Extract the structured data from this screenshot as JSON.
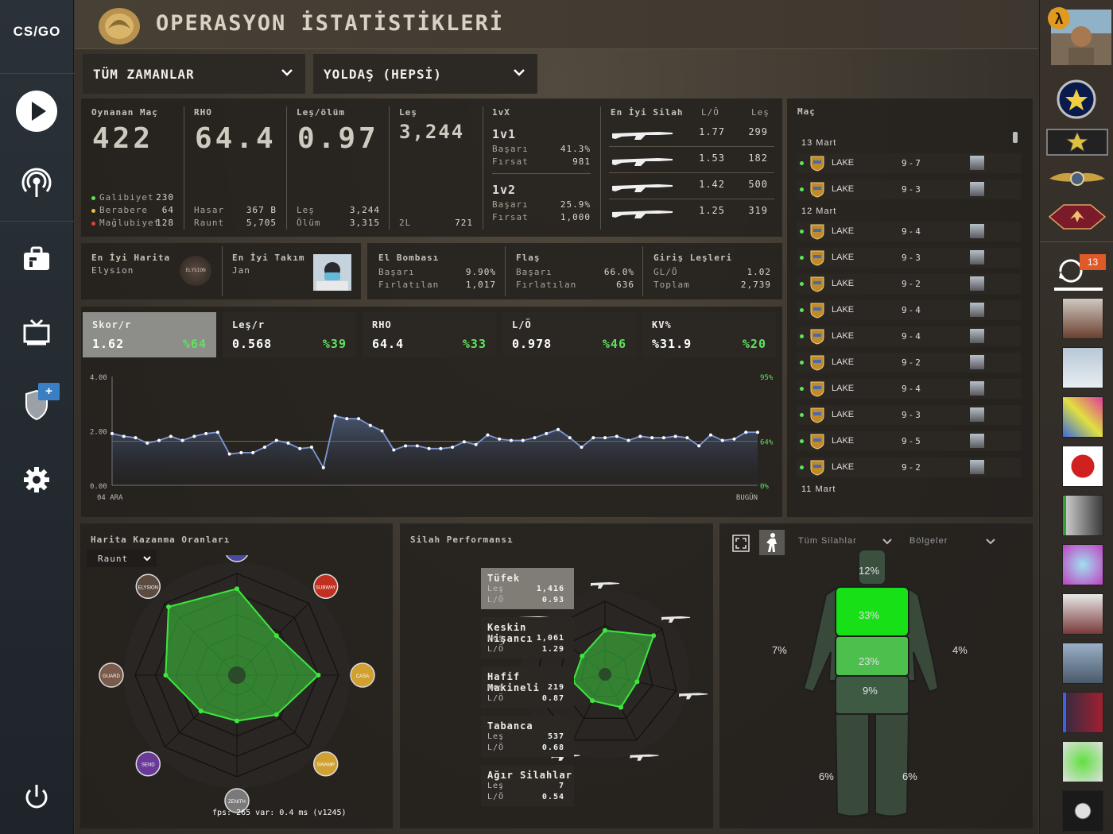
{
  "app": {
    "logo": "CS/GO",
    "title": "OPERASYON İSTATİSTİKLERİ"
  },
  "filters": {
    "time": "TÜM ZAMANLAR",
    "mate": "YOLDAŞ (HEPSİ)"
  },
  "overview": {
    "matches": {
      "label": "Oynanan Maç",
      "value": "422",
      "win_label": "Galibiyet",
      "win": "230",
      "draw_label": "Berabere",
      "draw": "64",
      "loss_label": "Mağlubiyet",
      "loss": "128"
    },
    "adr": {
      "label": "RHO",
      "value": "64.4",
      "dmg_label": "Hasar",
      "dmg": "367 B",
      "rounds_label": "Raunt",
      "rounds": "5,705"
    },
    "kd": {
      "label": "Leş/ölüm",
      "value": "0.97",
      "k_label": "Leş",
      "k": "3,244",
      "d_label": "Ölüm",
      "d": "3,315"
    },
    "kills": {
      "label": "Leş",
      "value": "3,244",
      "mk_label": "2L",
      "mk": "721"
    },
    "clutch": {
      "label": "1vX",
      "v1": "1v1",
      "v1_rate_label": "Başarı",
      "v1_rate": "41.3%",
      "v1_opp_label": "Fırsat",
      "v1_opp": "981",
      "v2": "1v2",
      "v2_rate_label": "Başarı",
      "v2_rate": "25.9%",
      "v2_opp_label": "Fırsat",
      "v2_opp": "1,000"
    },
    "weapons": {
      "label": "En İyi Silah",
      "kd_h": "L/Ö",
      "k_h": "Leş",
      "rows": [
        {
          "kd": "1.77",
          "k": "299"
        },
        {
          "kd": "1.53",
          "k": "182"
        },
        {
          "kd": "1.42",
          "k": "500"
        },
        {
          "kd": "1.25",
          "k": "319"
        }
      ]
    }
  },
  "best": {
    "map_label": "En İyi Harita",
    "map": "Elysion",
    "map_badge": "ELYSION",
    "team_label": "En İyi Takım",
    "team": "Jan"
  },
  "utility": {
    "he": {
      "label": "El Bombası",
      "a": "Başarı",
      "av": "9.90%",
      "b": "Fırlatılan",
      "bv": "1,017"
    },
    "flash": {
      "label": "Flaş",
      "a": "Başarı",
      "av": "66.0%",
      "b": "Fırlatılan",
      "bv": "636"
    },
    "entry": {
      "label": "Giriş Leşleri",
      "a": "GL/Ö",
      "av": "1.02",
      "b": "Toplam",
      "bv": "2,739"
    }
  },
  "stat_tabs": [
    {
      "name": "Skor/r",
      "value": "1.62",
      "pct": "%64"
    },
    {
      "name": "Leş/r",
      "value": "0.568",
      "pct": "%39"
    },
    {
      "name": "RHO",
      "value": "64.4",
      "pct": "%33"
    },
    {
      "name": "L/Ö",
      "value": "0.978",
      "pct": "%46"
    },
    {
      "name": "KV%",
      "value": "%31.9",
      "pct": "%20"
    }
  ],
  "chart_data": {
    "type": "line",
    "ylim": [
      0,
      4
    ],
    "yticks": [
      "4.00",
      "2.00",
      "0.00"
    ],
    "right_ticks": [
      "95%",
      "64%",
      "0%"
    ],
    "reference_y": 1.62,
    "x_start": "04 ARA",
    "x_end": "BUGÜN",
    "values": [
      1.9,
      1.8,
      1.75,
      1.55,
      1.65,
      1.8,
      1.65,
      1.8,
      1.9,
      1.95,
      1.15,
      1.2,
      1.2,
      1.4,
      1.65,
      1.55,
      1.35,
      1.4,
      0.65,
      2.55,
      2.45,
      2.45,
      2.2,
      2.0,
      1.3,
      1.45,
      1.45,
      1.35,
      1.35,
      1.4,
      1.6,
      1.5,
      1.85,
      1.7,
      1.65,
      1.65,
      1.75,
      1.9,
      2.05,
      1.75,
      1.4,
      1.75,
      1.75,
      1.8,
      1.65,
      1.8,
      1.75,
      1.75,
      1.8,
      1.75,
      1.45,
      1.85,
      1.65,
      1.7,
      1.95,
      1.95
    ]
  },
  "history": {
    "label": "Maç",
    "groups": [
      {
        "date": "13 Mart",
        "rows": [
          {
            "map": "LAKE",
            "score": "9-7"
          },
          {
            "map": "LAKE",
            "score": "9-3"
          }
        ]
      },
      {
        "date": "12 Mart",
        "rows": [
          {
            "map": "LAKE",
            "score": "9-4"
          },
          {
            "map": "LAKE",
            "score": "9-3"
          },
          {
            "map": "LAKE",
            "score": "9-2"
          },
          {
            "map": "LAKE",
            "score": "9-4"
          },
          {
            "map": "LAKE",
            "score": "9-4"
          },
          {
            "map": "LAKE",
            "score": "9-2"
          },
          {
            "map": "LAKE",
            "score": "9-4"
          },
          {
            "map": "LAKE",
            "score": "9-3"
          },
          {
            "map": "LAKE",
            "score": "9-5"
          },
          {
            "map": "LAKE",
            "score": "9-2"
          }
        ]
      },
      {
        "date": "11 Mart",
        "rows": []
      }
    ]
  },
  "map_win": {
    "label": "Harita Kazanma Oranları",
    "select": "Raunt",
    "badges": [
      "PRESENT",
      "SUBWAY",
      "CASA",
      "SWAMP",
      "ZENITH",
      "SEND",
      "GUARD",
      "ELYSION"
    ],
    "values": [
      0.85,
      0.55,
      0.8,
      0.55,
      0.45,
      0.5,
      0.7,
      0.95
    ],
    "fps": "fps:   265 var:  0.4 ms (v1245)"
  },
  "weapon_perf": {
    "label": "Silah Performansı",
    "cats": [
      {
        "name": "Tüfek",
        "a": "Leş",
        "av": "1,416",
        "b": "L/Ö",
        "bv": "0.93"
      },
      {
        "name": "Keskin Nişancı",
        "a": "Leş",
        "av": "1,061",
        "b": "L/Ö",
        "bv": "1.29"
      },
      {
        "name": "Hafif Makineli",
        "a": "Leş",
        "av": "219",
        "b": "L/Ö",
        "bv": "0.87"
      },
      {
        "name": "Tabanca",
        "a": "Leş",
        "av": "537",
        "b": "L/Ö",
        "bv": "0.68"
      },
      {
        "name": "Ağır Silahlar",
        "a": "Leş",
        "av": "7",
        "b": "L/Ö",
        "bv": "0.54"
      }
    ],
    "radar_values": [
      0.6,
      0.85,
      0.45,
      0.5,
      0.4,
      0.45,
      0.4
    ]
  },
  "body": {
    "filter1": "Tüm Silahlar",
    "filter2": "Bölgeler",
    "head": "12%",
    "chest": "33%",
    "stomach": "23%",
    "pelvis": "9%",
    "left_arm": "7%",
    "right_arm": "4%",
    "left_leg": "6%",
    "right_leg": "6%"
  },
  "friends": {
    "notif": "13"
  },
  "colors": {
    "green": "#5fe35f",
    "accent": "#3a7fc4",
    "bright_green": "#3de83d"
  }
}
